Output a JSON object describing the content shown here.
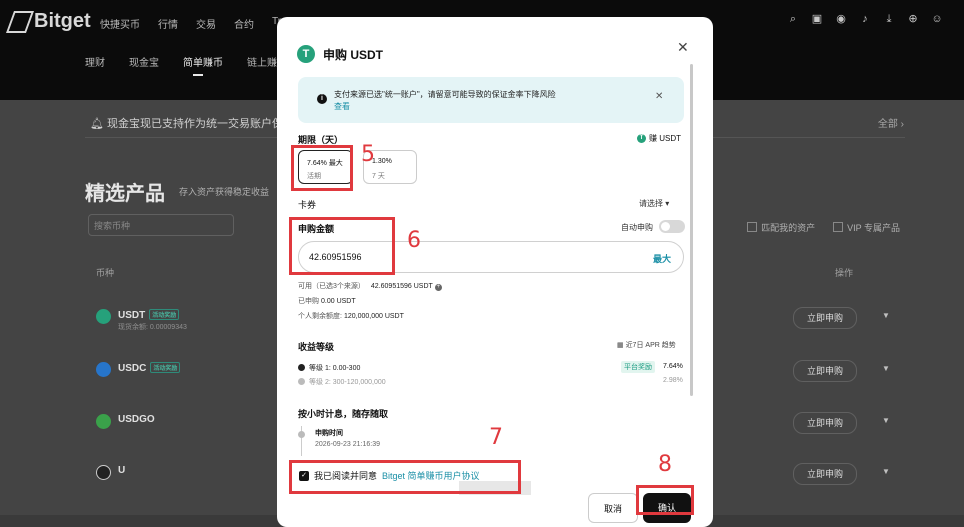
{
  "brand": {
    "name": "Bitget"
  },
  "topnav": [
    "快捷买币",
    "行情",
    "交易",
    "合约",
    "Tra"
  ],
  "subnav": [
    "理财",
    "现金宝",
    "简单赚币",
    "链上赚币"
  ],
  "subnav_active": 2,
  "toolbar_icons": [
    "search-icon",
    "wallet-icon",
    "user-icon",
    "bell-icon",
    "download-icon",
    "globe-icon",
    "avatar-icon"
  ],
  "page": {
    "notice": "现金宝现已支持作为统一交易账户保",
    "all_label": "全部 ›",
    "section_title": "精选产品",
    "section_subtitle": "存入资产获得稳定收益",
    "search_placeholder": "搜索币种",
    "filter_match": "匹配我的资产",
    "filter_vip": "VIP 专属产品",
    "col_coin": "币种",
    "col_action": "操作"
  },
  "products": [
    {
      "name": "USDT",
      "tag": "活动奖励",
      "balance": "现货余额: 0.00009343",
      "color": "#26a17b",
      "symbol": "T"
    },
    {
      "name": "USDC",
      "tag": "活动奖励",
      "balance": "",
      "color": "#2775ca",
      "symbol": "$"
    },
    {
      "name": "USDGO",
      "tag": "",
      "balance": "",
      "color": "#3aa14a",
      "symbol": "$"
    },
    {
      "name": "U",
      "tag": "",
      "balance": "",
      "color": "#222222",
      "symbol": "U"
    }
  ],
  "product_button": "立即申购",
  "modal": {
    "title": "申购 USDT",
    "alert_text": "支付来源已选\"统一账户\"，请留意可能导致的保证金率下降风险",
    "alert_link": "查看",
    "period_label": "期限（天）",
    "earn_label": "赚 USDT",
    "options": [
      {
        "rate": "7.64%",
        "tag": "最大",
        "term": "活期"
      },
      {
        "rate": "1.30%",
        "tag": "",
        "term": "7 天"
      }
    ],
    "coupon_label": "卡券",
    "coupon_select": "请选择 ▾",
    "amount_label": "申购金额",
    "auto_label": "自动申购",
    "amount_value": "42.60951596",
    "max_label": "最大",
    "available_label": "可用（已选3个来源）",
    "available_value": "42.60951596 USDT",
    "subscribed_label": "已申购",
    "subscribed_value": "0.00 USDT",
    "quota_label": "个人剩余额度:",
    "quota_value": "120,000,000 USDT",
    "tier_label": "收益等级",
    "trend_label": "近7日 APR 趋势",
    "tier1": "等级 1: 0.00-300",
    "tier2": "等级 2: 300-120,000,000",
    "bonus_label": "平台奖励",
    "rate1": "7.64%",
    "rate2": "2.98%",
    "hourly_label": "按小时计息，随存随取",
    "timeline_title": "申购时间",
    "timeline_time": "2026-09-23 21:16:39",
    "agree_text": "我已阅读并同意",
    "agree_link": "Bitget 简单赚币用户协议",
    "cancel_label": "取消",
    "confirm_label": "确认"
  },
  "annotations": [
    "5",
    "6",
    "7",
    "8"
  ],
  "colors": {
    "accent": "#1a8fa6",
    "annotation": "#e0393e",
    "usdt": "#26a17b"
  }
}
